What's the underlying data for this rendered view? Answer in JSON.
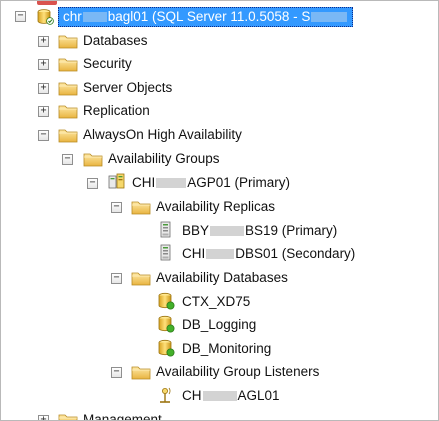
{
  "tree": {
    "server": {
      "prefix": "chr",
      "suffix": "bagl01 (SQL Server 11.0.5058 - S",
      "selected": true
    },
    "databases": "Databases",
    "security": "Security",
    "server_objects": "Server Objects",
    "replication": "Replication",
    "alwayson": "AlwaysOn High Availability",
    "availability_groups": "Availability Groups",
    "ag": {
      "prefix": "CHI",
      "suffix": "AGP01 (Primary)"
    },
    "availability_replicas": "Availability Replicas",
    "replica1": {
      "prefix": "BBY",
      "suffix": "BS19 (Primary)"
    },
    "replica2": {
      "prefix": "CHI",
      "suffix": "DBS01 (Secondary)"
    },
    "availability_databases": "Availability Databases",
    "db1": "CTX_XD75",
    "db2": "DB_Logging",
    "db3": "DB_Monitoring",
    "listeners": "Availability Group Listeners",
    "listener1": {
      "prefix": "CH",
      "suffix": "AGL01"
    },
    "management": "Management"
  },
  "icons": {
    "folder": "folder-icon",
    "server": "server-icon",
    "availability_group": "availability-group-icon",
    "replica": "replica-server-icon",
    "database": "database-icon",
    "listener": "listener-icon"
  },
  "colors": {
    "selection": "#3399ff",
    "folder": "#f2c94c",
    "db_status_green": "#43b02a"
  }
}
